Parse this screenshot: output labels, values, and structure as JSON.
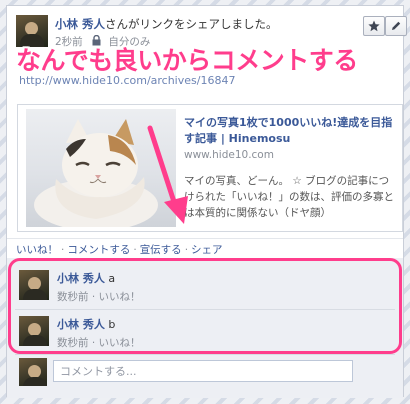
{
  "post": {
    "author": "小林 秀人",
    "action_text": "さんがリンクをシェアしました。",
    "time": "2秒前",
    "privacy": "自分のみ",
    "link_url": "http://www.hide10.com/archives/16847"
  },
  "annotation": {
    "headline": "なんでも良いからコメントする"
  },
  "link_preview": {
    "title": "マイの写真1枚で1000いいね!達成を目指す記事 | Hinemosu",
    "domain": "www.hide10.com",
    "description": "マイの写真、どーん。 ☆ ブログの記事につけられた「いいね！」の数は、評価の多寡とは本質的に関係ない（ドヤ顔）"
  },
  "actions": {
    "like": "いいね！",
    "comment": "コメントする",
    "promote": "宣伝する",
    "share": "シェア",
    "separator": "·"
  },
  "comments": [
    {
      "author": "小林 秀人",
      "text": "a",
      "meta": "数秒前 · いいね！"
    },
    {
      "author": "小林 秀人",
      "text": "b",
      "meta": "数秒前 · いいね！"
    }
  ],
  "composer": {
    "placeholder": "コメントする..."
  },
  "colors": {
    "accent": "#ff3d8c",
    "link": "#3b5998"
  },
  "icons": {
    "star": "star-icon",
    "edit": "pencil-icon",
    "privacy": "lock-icon"
  }
}
